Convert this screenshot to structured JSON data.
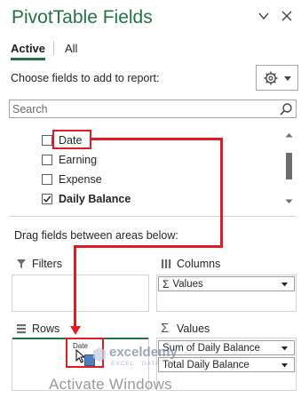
{
  "pane": {
    "title": "PivotTable Fields",
    "dropdown_icon": "chevron-down-icon",
    "close_icon": "close-icon"
  },
  "tabs": [
    {
      "label": "Active",
      "selected": true
    },
    {
      "label": "All",
      "selected": false
    }
  ],
  "choose_label": "Choose fields to add to report:",
  "search": {
    "placeholder": "Search",
    "value": ""
  },
  "fields": [
    {
      "label": "Date",
      "checked": false,
      "bold": false
    },
    {
      "label": "Earning",
      "checked": false,
      "bold": false
    },
    {
      "label": "Expense",
      "checked": false,
      "bold": false
    },
    {
      "label": "Daily Balance",
      "checked": true,
      "bold": true
    }
  ],
  "drag_label": "Drag fields between areas below:",
  "areas": {
    "filters": {
      "label": "Filters",
      "items": []
    },
    "columns": {
      "label": "Columns",
      "items": [
        "Values"
      ]
    },
    "rows": {
      "label": "Rows",
      "items": []
    },
    "values": {
      "label": "Values",
      "items": [
        "Sum of Daily Balance",
        "Total Daily Balance"
      ]
    }
  },
  "drag_ghost_text": "Date",
  "watermark": {
    "text": "Activate Windows",
    "brand": "exceldemy",
    "brand_sub": "EXCEL · DATA · BI"
  },
  "colors": {
    "accent": "#217346",
    "highlight": "#e01d25"
  }
}
